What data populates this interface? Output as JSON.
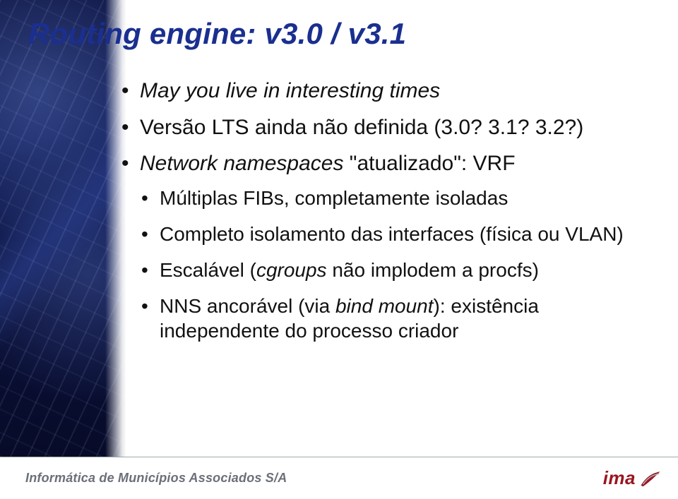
{
  "title": "Routing engine: v3.0 / v3.1",
  "bullets": {
    "b1": "May you live in interesting times",
    "b2": "Versão LTS ainda não definida (3.0? 3.1? 3.2?)",
    "b3_prefix": "Network namespaces",
    "b3_quoted": " \"atualizado\": VRF",
    "sub1": "Múltiplas FIBs, completamente isoladas",
    "sub2": "Completo isolamento das interfaces (física ou VLAN)",
    "sub3_a": "Escalável (",
    "sub3_b": "cgroups",
    "sub3_c": " não implodem a procfs)",
    "sub4_a": "NNS ancorável (via ",
    "sub4_b": "bind mount",
    "sub4_c": "): existência independente do processo criador"
  },
  "footer": {
    "org": "Informática de Municípios Associados S/A",
    "logo_text": "ima"
  }
}
